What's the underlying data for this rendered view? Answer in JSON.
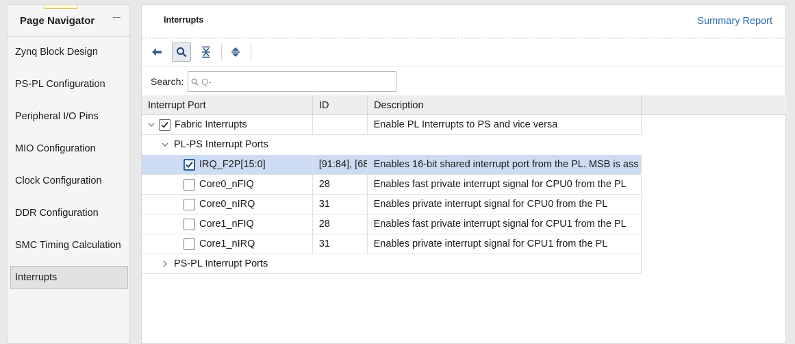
{
  "navigator": {
    "title": "Page Navigator",
    "items": [
      {
        "label": "Zynq Block Design"
      },
      {
        "label": "PS-PL Configuration"
      },
      {
        "label": "Peripheral I/O Pins"
      },
      {
        "label": "MIO Configuration"
      },
      {
        "label": "Clock Configuration"
      },
      {
        "label": "DDR Configuration"
      },
      {
        "label": "SMC Timing Calculation"
      },
      {
        "label": "Interrupts",
        "active": true
      }
    ]
  },
  "main": {
    "title": "Interrupts",
    "summary_link": "Summary Report",
    "toolbar": {
      "icons": [
        "back-arrow-icon",
        "search-icon",
        "collapse-all-icon",
        "expand-all-icon"
      ]
    },
    "search": {
      "label": "Search:",
      "placeholder": "Q-",
      "value": ""
    },
    "table": {
      "columns": [
        "Interrupt Port",
        "ID",
        "Description"
      ],
      "rows": [
        {
          "port": "Fabric Interrupts",
          "id": "",
          "description": "Enable PL Interrupts to PS and vice versa",
          "level": 0,
          "expanded": true,
          "checkbox": "checked"
        },
        {
          "port": "PL-PS Interrupt Ports",
          "id": "",
          "description": "",
          "level": 1,
          "expanded": true,
          "checkbox": "none"
        },
        {
          "port": "IRQ_F2P[15:0]",
          "id": "[91:84], [68",
          "description": "Enables 16-bit shared interrupt port from the PL. MSB is ass",
          "level": 2,
          "checkbox": "checked",
          "selected": true
        },
        {
          "port": "Core0_nFIQ",
          "id": "28",
          "description": "Enables fast private interrupt signal for CPU0 from the PL",
          "level": 2,
          "checkbox": "unchecked"
        },
        {
          "port": "Core0_nIRQ",
          "id": "31",
          "description": "Enables private interrupt signal for CPU0 from the PL",
          "level": 2,
          "checkbox": "unchecked"
        },
        {
          "port": "Core1_nFIQ",
          "id": "28",
          "description": "Enables fast private interrupt signal for CPU1 from the PL",
          "level": 2,
          "checkbox": "unchecked"
        },
        {
          "port": "Core1_nIRQ",
          "id": "31",
          "description": "Enables private interrupt signal for CPU1 from the PL",
          "level": 2,
          "checkbox": "unchecked"
        },
        {
          "port": "PS-PL Interrupt Ports",
          "id": "",
          "description": "",
          "level": 1,
          "expanded": false,
          "checkbox": "none"
        }
      ]
    }
  },
  "colors": {
    "link": "#2a6db5",
    "selected_row": "#cddcf2",
    "checkbox_selected_border": "#2a5ea8",
    "toolbar_icon": "#3a5f8f"
  }
}
